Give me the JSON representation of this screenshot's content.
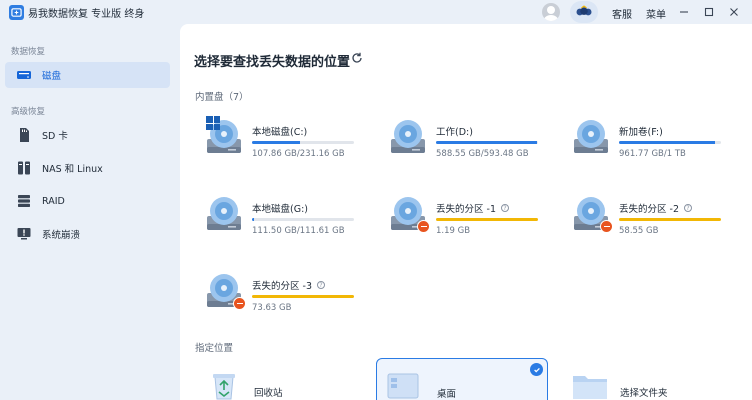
{
  "app": {
    "title": "易我数据恢复 专业版 终身"
  },
  "titlebar": {
    "service_label": "客服",
    "menu_label": "菜单"
  },
  "sidebar": {
    "sections": [
      {
        "title": "数据恢复"
      },
      {
        "title": "高级恢复"
      }
    ],
    "items": [
      {
        "label": "磁盘",
        "icon": "disk-icon",
        "active": true
      },
      {
        "label": "SD 卡",
        "icon": "sd-card-icon"
      },
      {
        "label": "NAS 和 Linux",
        "icon": "nas-icon"
      },
      {
        "label": "RAID",
        "icon": "raid-icon"
      },
      {
        "label": "系统崩溃",
        "icon": "monitor-alert-icon"
      }
    ]
  },
  "main": {
    "heading": "选择要查找丢失数据的位置",
    "internal_label": "内置盘（7）",
    "location_label": "指定位置",
    "drives": [
      {
        "name": "本地磁盘(C:)",
        "size": "107.86 GB/231.16 GB",
        "usage": 0.47,
        "color": "#2a7be4",
        "system": true,
        "lost": false
      },
      {
        "name": "工作(D:)",
        "size": "588.55 GB/593.48 GB",
        "usage": 0.99,
        "color": "#2a7be4",
        "system": false,
        "lost": false
      },
      {
        "name": "新加卷(F:)",
        "size": "961.77 GB/1 TB",
        "usage": 0.94,
        "color": "#2a7be4",
        "system": false,
        "lost": false
      },
      {
        "name": "本地磁盘(G:)",
        "size": "111.50 GB/111.61 GB",
        "usage": 0.02,
        "color": "#2a7be4",
        "system": false,
        "lost": false
      },
      {
        "name": "丢失的分区 -1",
        "size": "1.19 GB",
        "usage": 1.0,
        "color": "#f2b705",
        "system": false,
        "lost": true
      },
      {
        "name": "丢失的分区 -2",
        "size": "58.55 GB",
        "usage": 1.0,
        "color": "#f2b705",
        "system": false,
        "lost": true
      },
      {
        "name": "丢失的分区 -3",
        "size": "73.63 GB",
        "usage": 1.0,
        "color": "#f2b705",
        "system": false,
        "lost": true
      }
    ],
    "locations": [
      {
        "name": "回收站",
        "icon": "recycle-bin-icon"
      },
      {
        "name": "桌面",
        "icon": "desktop-icon",
        "selected": true
      },
      {
        "name": "选择文件夹",
        "icon": "folder-icon"
      }
    ]
  },
  "colors": {
    "accent": "#2a7be4",
    "lost": "#f2b705",
    "lost_badge": "#e8541f"
  }
}
